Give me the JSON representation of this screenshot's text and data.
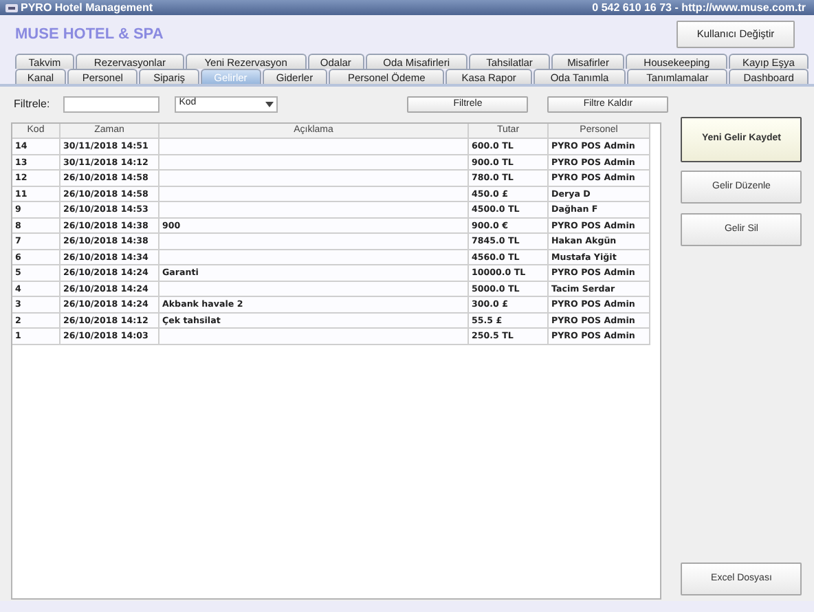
{
  "window": {
    "title": "PYRO Hotel Management",
    "contact": "0 542 610 16 73  -  http://www.muse.com.tr"
  },
  "header": {
    "hotel_name": "MUSE HOTEL & SPA",
    "user_button": "Kullanıcı Değiştir"
  },
  "tabs": [
    [
      {
        "label": "Takvim",
        "selected": false
      },
      {
        "label": "Rezervasyonlar",
        "selected": false
      },
      {
        "label": "Yeni Rezervasyon",
        "selected": false
      },
      {
        "label": "Odalar",
        "selected": false
      },
      {
        "label": "Oda Misafirleri",
        "selected": false
      },
      {
        "label": "Tahsilatlar",
        "selected": false
      },
      {
        "label": "Misafirler",
        "selected": false
      },
      {
        "label": "Housekeeping",
        "selected": false
      },
      {
        "label": "Kayıp Eşya",
        "selected": false
      }
    ],
    [
      {
        "label": "Kanal",
        "selected": false
      },
      {
        "label": "Personel",
        "selected": false
      },
      {
        "label": "Sipariş",
        "selected": false
      },
      {
        "label": "Gelirler",
        "selected": true
      },
      {
        "label": "Giderler",
        "selected": false
      },
      {
        "label": "Personel Ödeme",
        "selected": false
      },
      {
        "label": "Kasa Rapor",
        "selected": false
      },
      {
        "label": "Oda Tanımla",
        "selected": false
      },
      {
        "label": "Tanımlamalar",
        "selected": false
      },
      {
        "label": "Dashboard",
        "selected": false
      }
    ]
  ],
  "filter": {
    "label": "Filtrele:",
    "field_select": "Kod",
    "buttons": [
      "Filtrele",
      "Filtre Kaldır"
    ]
  },
  "table": {
    "columns": [
      "Kod",
      "Zaman",
      "Açıklama",
      "Tutar",
      "Personel"
    ],
    "rows": [
      [
        "14",
        "30/11/2018 14:51",
        "",
        "600.0 TL",
        "PYRO POS Admin"
      ],
      [
        "13",
        "30/11/2018 14:12",
        "",
        "900.0 TL",
        "PYRO POS Admin"
      ],
      [
        "12",
        "26/10/2018 14:58",
        "",
        "780.0 TL",
        "PYRO POS Admin"
      ],
      [
        "11",
        "26/10/2018 14:58",
        "",
        "450.0 £",
        "Derya D"
      ],
      [
        "9",
        "26/10/2018 14:53",
        "",
        "4500.0 TL",
        "Dağhan F"
      ],
      [
        "8",
        "26/10/2018 14:38",
        "900",
        "900.0 €",
        "PYRO POS Admin"
      ],
      [
        "7",
        "26/10/2018 14:38",
        "",
        "7845.0 TL",
        "Hakan Akgün"
      ],
      [
        "6",
        "26/10/2018 14:34",
        "",
        "4560.0 TL",
        "Mustafa Yiğit"
      ],
      [
        "5",
        "26/10/2018 14:24",
        "Garanti",
        "10000.0 TL",
        "PYRO POS Admin"
      ],
      [
        "4",
        "26/10/2018 14:24",
        "",
        "5000.0 TL",
        "Tacim Serdar"
      ],
      [
        "3",
        "26/10/2018 14:24",
        "Akbank havale 2",
        "300.0 £",
        "PYRO POS Admin"
      ],
      [
        "2",
        "26/10/2018 14:12",
        "Çek tahsilat",
        "55.5 £",
        "PYRO POS Admin"
      ],
      [
        "1",
        "26/10/2018 14:03",
        "",
        "250.5 TL",
        "PYRO POS Admin"
      ]
    ]
  },
  "actions": [
    {
      "label": "Yeni Gelir Kaydet",
      "focused": true
    },
    {
      "label": "Gelir Düzenle",
      "focused": false
    },
    {
      "label": "Gelir Sil",
      "focused": false
    }
  ],
  "export_button": "Excel Dosyası"
}
